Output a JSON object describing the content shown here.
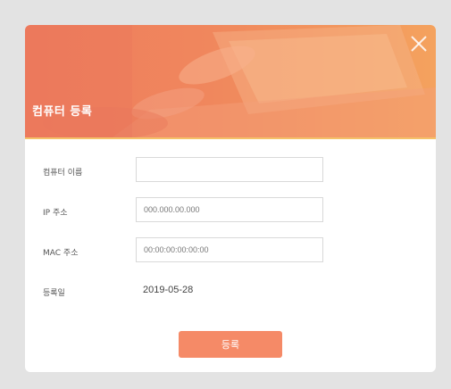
{
  "dialog": {
    "title": "컴퓨터 등록",
    "close_icon": "close-icon",
    "banner_colors": [
      "#ee7c5d",
      "#f4a25e"
    ]
  },
  "form": {
    "computer_name": {
      "label": "컴퓨터 이름",
      "value": "",
      "placeholder": ""
    },
    "ip_address": {
      "label": "IP 주소",
      "value": "",
      "placeholder": "000.000.00.000"
    },
    "mac_address": {
      "label": "MAC 주소",
      "value": "",
      "placeholder": "00:00:00:00:00:00"
    },
    "registration_date": {
      "label": "등록일",
      "value": "2019-05-28"
    }
  },
  "actions": {
    "submit_label": "등록",
    "submit_color": "#f58a67"
  }
}
